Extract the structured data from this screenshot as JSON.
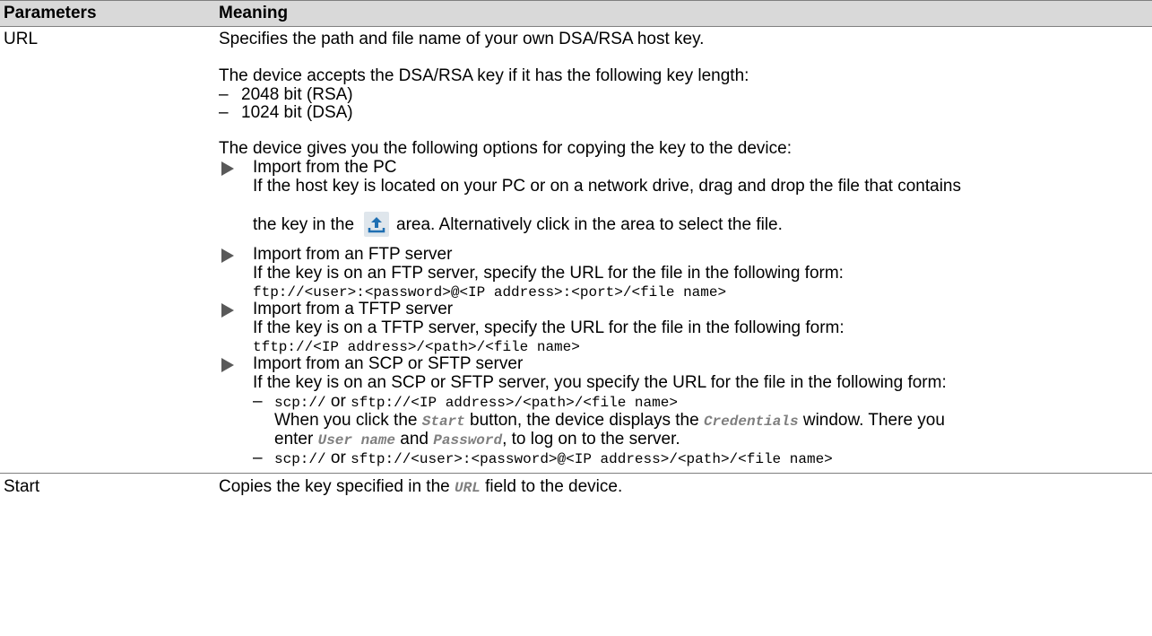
{
  "table": {
    "headers": {
      "param": "Parameters",
      "meaning": "Meaning"
    },
    "url_row": {
      "param": "URL",
      "intro": "Specifies the path and file name of your own DSA/RSA host key.",
      "keylen_intro": "The device accepts the DSA/RSA key if it has the following key length:",
      "keylen_items": [
        "2048 bit (RSA)",
        "1024 bit (DSA)"
      ],
      "options_intro": "The device gives you the following options for copying the key to the device:",
      "pc": {
        "title": "Import from the PC",
        "line1": "If the host key is located on your PC or on a network drive, drag and drop the file that contains",
        "line2_pre": "the key in the",
        "line2_post": "area. Alternatively click in the area to select the file."
      },
      "ftp": {
        "title": "Import from an FTP server",
        "desc": "If the key is on an FTP server, specify the URL for the file in the following form:",
        "code": "ftp://<user>:<password>@<IP address>:<port>/<file name>"
      },
      "tftp": {
        "title": "Import from a TFTP server",
        "desc": "If the key is on a TFTP server, specify the URL for the file in the following form:",
        "code": "tftp://<IP address>/<path>/<file name>"
      },
      "scp": {
        "title": "Import from an SCP or SFTP server",
        "desc": "If the key is on an SCP or SFTP server, you specify the URL for the file in the following form:",
        "item1_code1": "scp://",
        "item1_or": "or",
        "item1_code2": "sftp://<IP address>/<path>/<file name>",
        "item1_text1": "When you click the",
        "item1_em1": "Start",
        "item1_text2": "button, the device displays the",
        "item1_em2": "Credentials",
        "item1_text3": "window. There you",
        "item1_text4": "enter",
        "item1_em3": "User name",
        "item1_text5": "and",
        "item1_em4": "Password",
        "item1_text6": ", to log on to the server.",
        "item2_code1": "scp://",
        "item2_or": "or",
        "item2_code2": "sftp://<user>:<password>@<IP address>/<path>/<file name>"
      }
    },
    "start_row": {
      "param": "Start",
      "text1": "Copies the key specified in the",
      "em": "URL",
      "text2": "field to the device."
    }
  },
  "dash_char": "–",
  "colors": {
    "header_bg": "#d9d9d9",
    "rule": "#7f7f7f",
    "arrow": "#595959",
    "icon_blue": "#1f6fb2"
  },
  "icons": {
    "upload": "upload-icon"
  }
}
